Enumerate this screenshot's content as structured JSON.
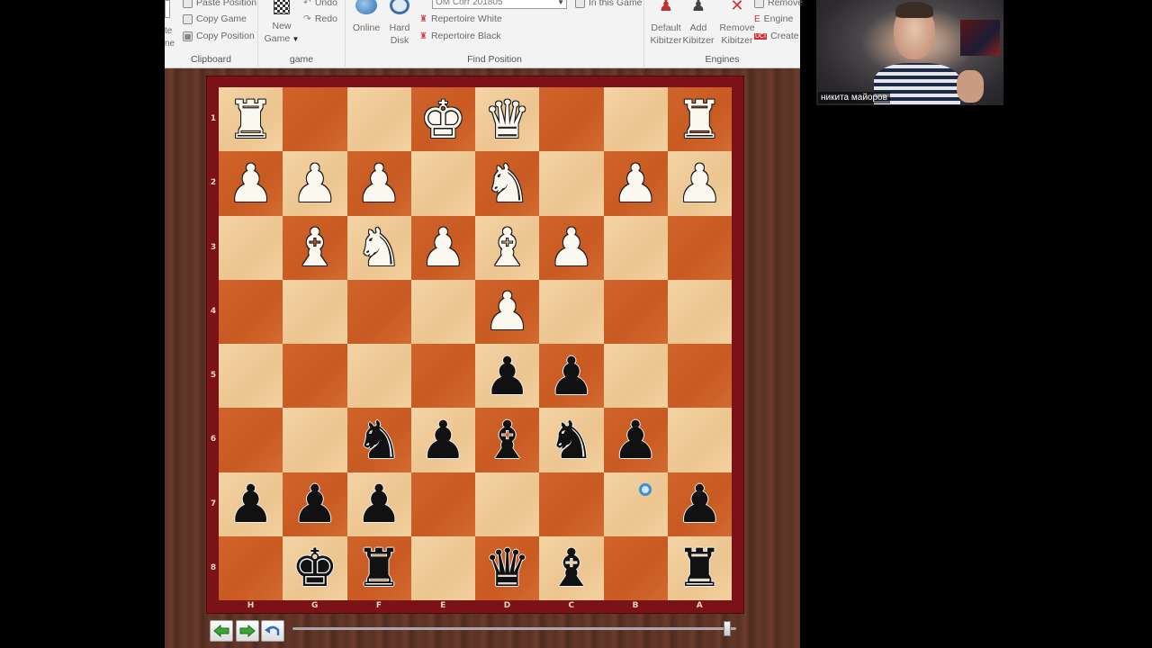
{
  "ribbon": {
    "clipboard": {
      "title": "Clipboard",
      "paste_position": "Paste Position",
      "copy_game": "Copy Game",
      "copy_position": "Copy Position",
      "partial_left_1": "te",
      "partial_left_2": "ne"
    },
    "game": {
      "title": "game",
      "new_game": "New",
      "new_game_2": "Game",
      "undo": "Undo",
      "redo": "Redo"
    },
    "find_position": {
      "title": "Find Position",
      "online": "Online",
      "hard_disk": "Hard",
      "hard_disk_2": "Disk",
      "database_select": "OM Corr 201805",
      "repertoire_white": "Repertoire White",
      "repertoire_black": "Repertoire Black",
      "in_this_game": "In this Game"
    },
    "engines": {
      "title": "Engines",
      "default_kibitzer": "Default",
      "default_kibitzer_2": "Kibitzer",
      "add_kibitzer": "Add",
      "add_kibitzer_2": "Kibitzer",
      "remove_kibitzer": "Remove",
      "remove_kibitzer_2": "Kibitzer",
      "remove": "Remove",
      "engine": "Engine",
      "create": "Create"
    }
  },
  "board": {
    "orientation": "black-bottom",
    "ranks": [
      "1",
      "2",
      "3",
      "4",
      "5",
      "6",
      "7",
      "8"
    ],
    "files": [
      "H",
      "G",
      "F",
      "E",
      "D",
      "C",
      "B",
      "A"
    ],
    "rows": [
      [
        "wR",
        "",
        "",
        "wK",
        "wQ",
        "",
        "",
        "wR"
      ],
      [
        "wP",
        "wP",
        "wP",
        "",
        "wN",
        "",
        "wP",
        "wP"
      ],
      [
        "",
        "wB",
        "wN",
        "wP",
        "wB",
        "wP",
        "",
        ""
      ],
      [
        "",
        "",
        "",
        "",
        "wP",
        "",
        "",
        ""
      ],
      [
        "",
        "",
        "",
        "",
        "bP",
        "bP",
        "",
        ""
      ],
      [
        "",
        "",
        "bN",
        "bP",
        "bB",
        "bN",
        "bP",
        ""
      ],
      [
        "bP",
        "bP",
        "bP",
        "",
        "",
        "",
        "",
        "bP"
      ],
      [
        "",
        "bK",
        "bR",
        "",
        "bQ",
        "bB",
        "",
        "bR"
      ]
    ]
  },
  "navigation": {
    "back_icon": "arrow-left-icon",
    "forward_icon": "arrow-right-icon",
    "takeback_icon": "undo-arrow-icon",
    "slider_position": 0.99
  },
  "webcam": {
    "participant_name": "никита майоров"
  },
  "colors": {
    "light_square": "#f0cc98",
    "dark_square": "#cc5f26",
    "board_frame": "#7a1217",
    "wood": "#5b3326"
  }
}
